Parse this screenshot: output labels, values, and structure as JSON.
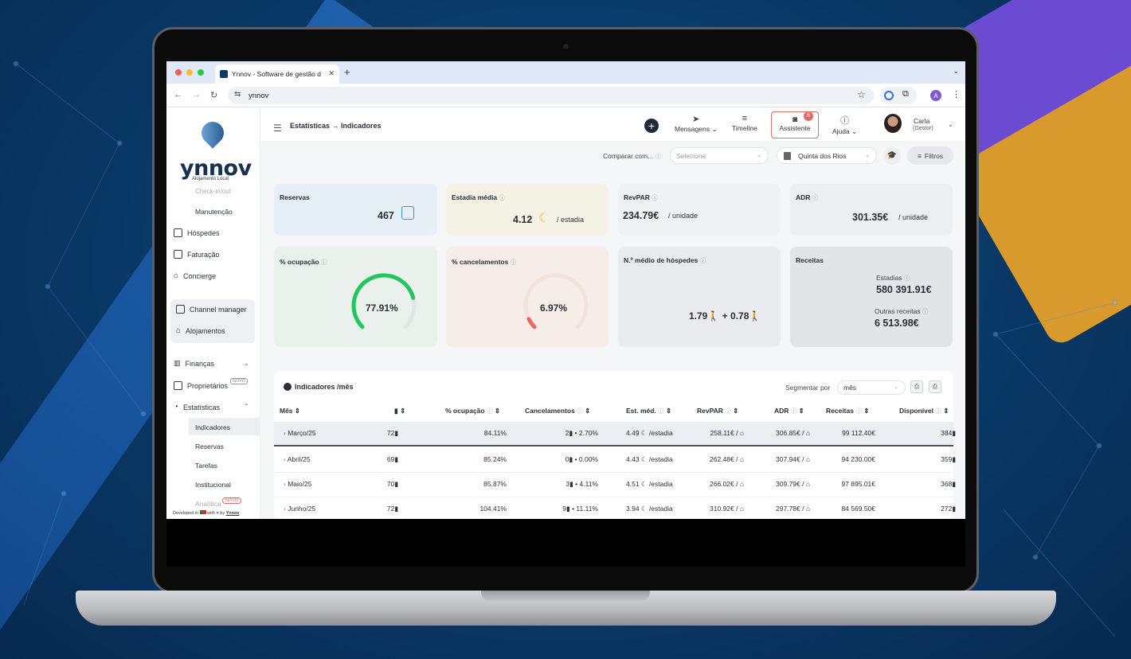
{
  "browser": {
    "tab_title": "Ynnov - Software de gestão d",
    "url": "ynnov",
    "profile_initial": "A"
  },
  "sidebar": {
    "logo": "ynnov",
    "logo_sub": "Alojamento Local",
    "cut_item": "Check-in/out",
    "items": {
      "manutencao": "Manutenção",
      "hospedes": "Hóspedes",
      "faturacao": "Faturação",
      "concierge": "Concierge",
      "channel": "Channel manager",
      "alojamentos": "Alojamentos",
      "financas": "Finanças",
      "proprietarios": "Proprietários",
      "proprietarios_badge": "NOVO",
      "estatisticas": "Estatísticas",
      "indicadores": "Indicadores",
      "reservas": "Reservas",
      "tarefas": "Tarefas",
      "institucional": "Institucional",
      "analitica": "Analítica",
      "analitica_badge": "NOVO"
    },
    "footer_a": "Developed in",
    "footer_b": "with",
    "footer_c": "by",
    "footer_brand": "Ynnov"
  },
  "header": {
    "breadcrumb": "Estatísticas → Indicadores",
    "mensagens": "Mensagens",
    "timeline": "Timeline",
    "assistente": "Assistente",
    "assistente_badge": "8",
    "ajuda": "Ajuda",
    "user_name": "Carla",
    "user_role": "(Gestor)"
  },
  "filters": {
    "compare_label": "Comparar com...",
    "compare_placeholder": "Selecione",
    "property": "Quinta dos Rios",
    "filters_label": "Filtros"
  },
  "kpis": {
    "reservas": {
      "title": "Reservas",
      "value": "467"
    },
    "estadia": {
      "title": "Estadia média",
      "value": "4.12",
      "unit": "/ estadia"
    },
    "revpar": {
      "title": "RevPAR",
      "value": "234.79€",
      "unit": "/ unidade"
    },
    "adr": {
      "title": "ADR",
      "value": "301.35€",
      "unit": "/ unidade"
    },
    "ocupacao": {
      "title": "% ocupação",
      "value": "77.91%",
      "fraction": 0.7791
    },
    "cancelamentos": {
      "title": "% cancelamentos",
      "value": "6.97%",
      "fraction": 0.0697
    },
    "hospedes": {
      "title": "N.º médio de hóspedes",
      "adults": "1.79",
      "plus": "+",
      "children": "0.78"
    },
    "receitas": {
      "title": "Receitas",
      "estadias_label": "Estadias",
      "estadias_value": "580 391.91€",
      "outras_label": "Outras receitas",
      "outras_value": "6 513.98€"
    }
  },
  "colors": {
    "green": "#22c55e",
    "red": "#e26b6b",
    "accent": "#e26b6b"
  },
  "table": {
    "title": "Indicadores /mês",
    "segment_label": "Segmentar por",
    "segment_value": "mês",
    "headers": {
      "mes": "Mês",
      "ocupacao": "% ocupação",
      "cancel": "Cancelamentos",
      "estmed": "Est. méd.",
      "revpar": "RevPAR",
      "adr": "ADR",
      "receitas": "Receitas",
      "disponivel": "Disponível"
    },
    "rows": [
      {
        "mes": "Março/25",
        "res": "72",
        "ocup": "84.11%",
        "canc_n": "2",
        "canc_p": "2.70%",
        "est": "4.49",
        "est_unit": "/estadia",
        "revpar": "258.11€ /",
        "adr": "306.85€ /",
        "receitas": "99 112.40€",
        "disp": "384"
      },
      {
        "mes": "Abril/25",
        "res": "69",
        "ocup": "85.24%",
        "canc_n": "0",
        "canc_p": "0.00%",
        "est": "4.43",
        "est_unit": "/estadia",
        "revpar": "262.48€ /",
        "adr": "307.94€ /",
        "receitas": "94 230.00€",
        "disp": "359"
      },
      {
        "mes": "Maio/25",
        "res": "70",
        "ocup": "85.87%",
        "canc_n": "3",
        "canc_p": "4.11%",
        "est": "4.51",
        "est_unit": "/estadia",
        "revpar": "266.02€ /",
        "adr": "309.79€ /",
        "receitas": "97 895.01€",
        "disp": "368"
      },
      {
        "mes": "Junho/25",
        "res": "72",
        "ocup": "104.41%",
        "canc_n": "9",
        "canc_p": "11.11%",
        "est": "3.94",
        "est_unit": "/estadia",
        "revpar": "310.92€ /",
        "adr": "297.78€ /",
        "receitas": "84 569.50€",
        "disp": "272"
      }
    ]
  }
}
